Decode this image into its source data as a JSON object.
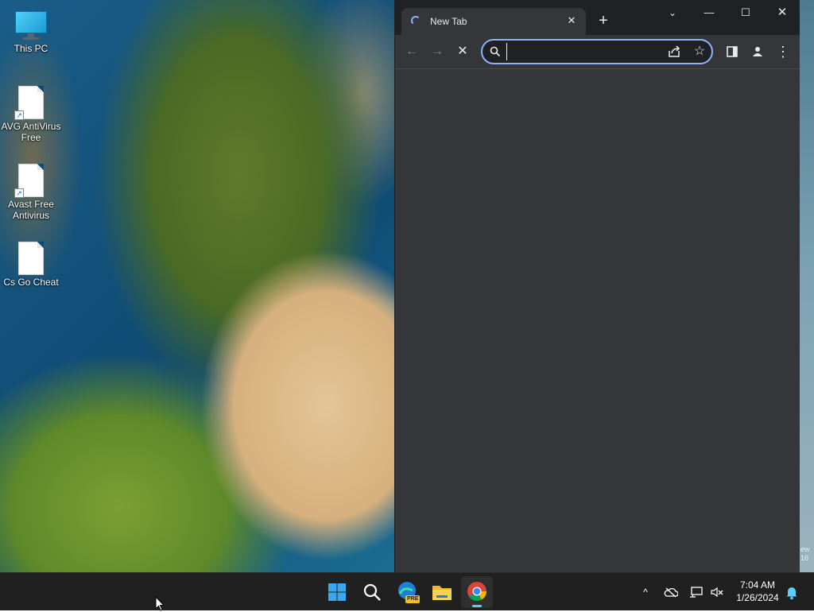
{
  "desktop": {
    "icons": [
      {
        "label": "This PC"
      },
      {
        "label": "AVG AntiVirus Free"
      },
      {
        "label": "Avast Free Antivirus"
      },
      {
        "label": "Cs Go Cheat"
      }
    ],
    "watermark_fragment": "ew\n16"
  },
  "browser": {
    "tab": {
      "title": "New Tab",
      "close": "✕"
    },
    "new_tab_symbol": "+",
    "window_controls": {
      "tab_search": "⌄",
      "minimize": "—",
      "maximize": "☐",
      "close": "✕"
    },
    "toolbar": {
      "back": "←",
      "forward": "→",
      "stop": "✕",
      "star": "☆",
      "menu": "⋮"
    },
    "omnibox": {
      "value": "",
      "placeholder": ""
    }
  },
  "taskbar": {
    "apps": [
      "Start",
      "Search",
      "Microsoft Edge Preview",
      "File Explorer",
      "Google Chrome"
    ],
    "edge_badge": "PRE",
    "tray": {
      "overflow": "^"
    },
    "clock": {
      "time": "7:04 AM",
      "date": "1/26/2024"
    }
  },
  "colors": {
    "chrome_dark": "#35363a",
    "titlebar": "#202124",
    "accent_blue": "#8ab4f8",
    "taskbar": "#202020",
    "active_indicator": "#60cdff"
  }
}
